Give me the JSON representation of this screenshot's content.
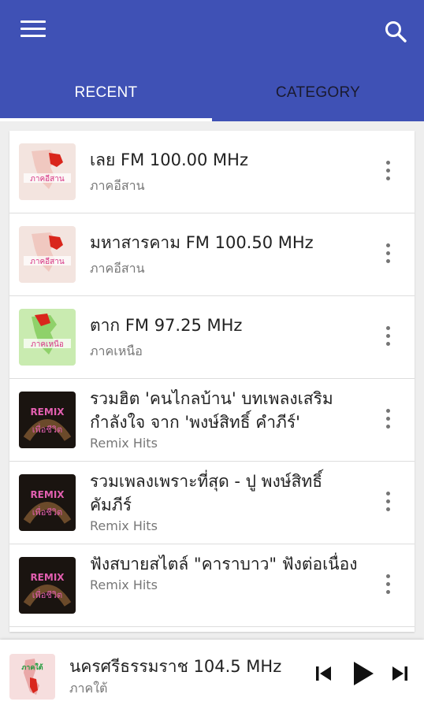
{
  "tabs": {
    "recent": "RECENT",
    "category": "CATEGORY"
  },
  "colors": {
    "appbar": "#3f51b5",
    "tab_selected": "#ffffff",
    "tab_unselected": "#1a1a2e"
  },
  "list": [
    {
      "title": "เลย FM 100.00 MHz",
      "subtitle": "ภาคอีสาน",
      "thumb": "isan-map-logo"
    },
    {
      "title": "มหาสารคาม FM 100.50 MHz",
      "subtitle": "ภาคอีสาน",
      "thumb": "isan-map-logo"
    },
    {
      "title": "ตาก FM 97.25 MHz",
      "subtitle": "ภาคเหนือ",
      "thumb": "north-map-logo"
    },
    {
      "title": "รวมฮิต 'คนไกลบ้าน' บทเพลงเสริมกำลังใจ จาก 'พงษ์สิทธิ์ คำภีร์'",
      "subtitle": "Remix Hits",
      "thumb": "remix-logo"
    },
    {
      "title": "รวมเพลงเพราะที่สุด - ปู พงษ์สิทธิ์ คัมภีร์",
      "subtitle": "Remix Hits",
      "thumb": "remix-logo"
    },
    {
      "title": "ฟังสบายสไตล์ \"คาราบาว\" ฟังต่อเนื่อง",
      "subtitle": "Remix Hits",
      "thumb": "remix-logo"
    }
  ],
  "player": {
    "title": "นครศรีธรรมราช 104.5 MHz",
    "subtitle": "ภาคใต้",
    "thumb": "south-map-logo"
  }
}
